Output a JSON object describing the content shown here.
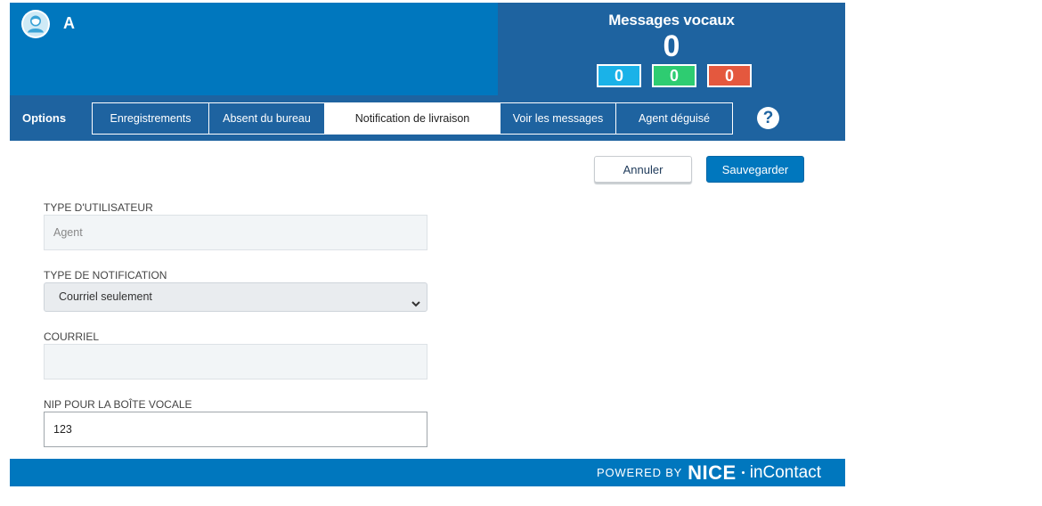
{
  "user": {
    "initial": "A"
  },
  "voicemail": {
    "title": "Messages vocaux",
    "total": "0",
    "counts": [
      {
        "value": "0",
        "color": "#1ab2e8"
      },
      {
        "value": "0",
        "color": "#2ecc71"
      },
      {
        "value": "0",
        "color": "#e4583e"
      }
    ]
  },
  "nav": {
    "label": "Options",
    "tabs": [
      {
        "label": "Enregistrements",
        "active": false
      },
      {
        "label": "Absent du bureau",
        "active": false
      },
      {
        "label": "Notification de livraison",
        "active": true
      },
      {
        "label": "Voir les messages",
        "active": false
      },
      {
        "label": "Agent déguisé",
        "active": false
      }
    ],
    "help_symbol": "?"
  },
  "actions": {
    "cancel_label": "Annuler",
    "save_label": "Sauvegarder"
  },
  "form": {
    "user_type": {
      "label": "TYPE D'UTILISATEUR",
      "value": "Agent"
    },
    "notification_type": {
      "label": "TYPE DE NOTIFICATION",
      "value": "Courriel seulement"
    },
    "email": {
      "label": "COURRIEL",
      "value": ""
    },
    "voicemail_pin": {
      "label": "NIP POUR LA BOÎTE VOCALE",
      "value": "123"
    }
  },
  "footer": {
    "powered_by": "POWERED BY",
    "brand_nice": "NICE",
    "brand_incontact": "inContact"
  },
  "colors": {
    "header_left": "#0077be",
    "header_right": "#1e63a0",
    "accent": "#0077be"
  },
  "icons": {
    "avatar": "user-avatar-icon",
    "help": "help-icon",
    "chevron": "chevron-down-icon"
  }
}
